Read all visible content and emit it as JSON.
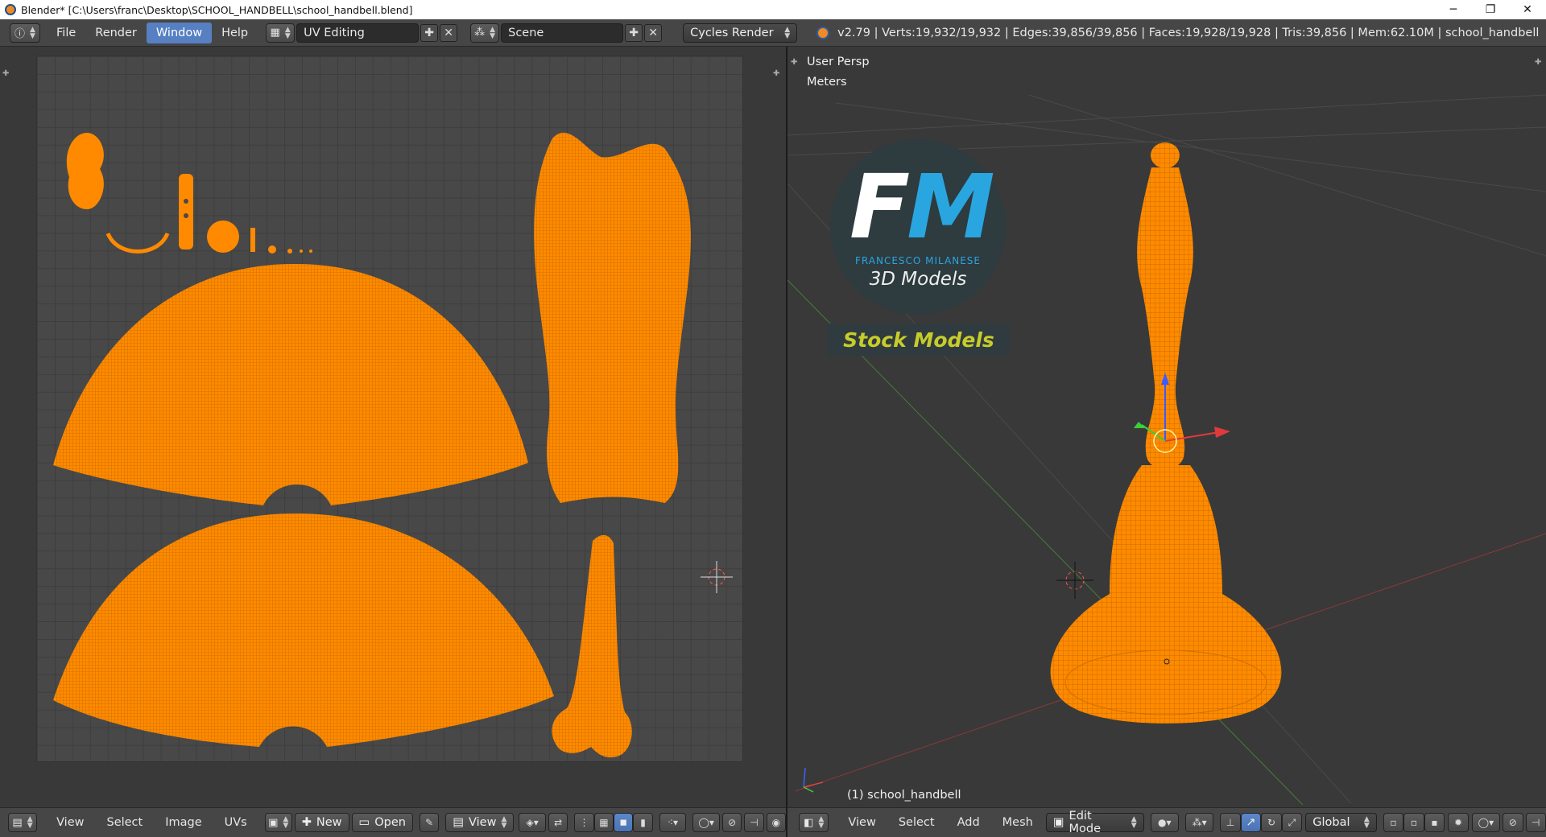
{
  "titlebar": {
    "title": "Blender* [C:\\Users\\franc\\Desktop\\SCHOOL_HANDBELL\\school_handbell.blend]",
    "minimize": "─",
    "maximize": "❐",
    "close": "✕"
  },
  "infobar": {
    "menus": [
      "File",
      "Render",
      "Window",
      "Help"
    ],
    "active_menu": "Window",
    "screen_layout": "UV Editing",
    "scene": "Scene",
    "render_engine": "Cycles Render",
    "stats": "v2.79 | Verts:19,932/19,932 | Edges:39,856/39,856 | Faces:19,928/19,928 | Tris:39,856 | Mem:62.10M | school_handbell"
  },
  "viewport": {
    "view_name": "User Persp",
    "units": "Meters",
    "object_label": "(1) school_handbell",
    "logo": {
      "initials_f": "F",
      "initials_m": "M",
      "author": "FRANCESCO MILANESE",
      "subtitle": "3D Models",
      "banner": "Stock Models"
    }
  },
  "uv_footer": {
    "menus": [
      "View",
      "Select",
      "Image",
      "UVs"
    ],
    "new_label": "New",
    "open_label": "Open",
    "view_label": "View"
  },
  "view3d_footer": {
    "menus": [
      "View",
      "Select",
      "Add",
      "Mesh"
    ],
    "mode": "Edit Mode",
    "orientation": "Global"
  },
  "colors": {
    "mesh": "#ff8a00",
    "accent": "#5680c2",
    "logo_blue": "#29a6e0",
    "logo_banner_text": "#c8cc2a"
  }
}
